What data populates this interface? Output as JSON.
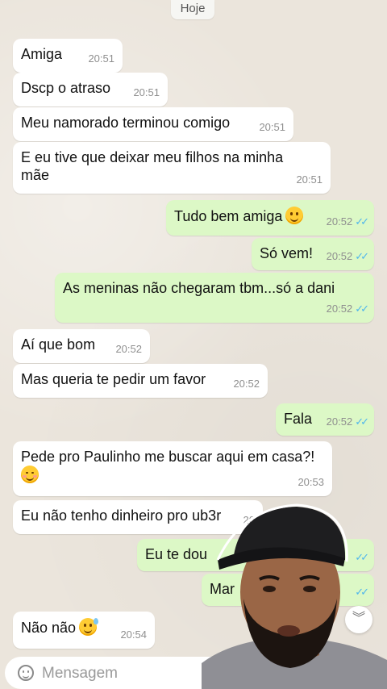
{
  "date_chip": "Hoje",
  "messages": [
    {
      "dir": "in",
      "text": "Amiga",
      "time": "20:51"
    },
    {
      "dir": "in",
      "text": "Dscp o atraso",
      "time": "20:51"
    },
    {
      "dir": "in",
      "text": "Meu namorado terminou comigo",
      "time": "20:51"
    },
    {
      "dir": "in",
      "text": "E eu tive que deixar meu filhos na minha",
      "text2": "mãe",
      "time": "20:51"
    },
    {
      "dir": "out",
      "text": "Tudo bem amiga",
      "time": "20:52",
      "emoji": "smiling-face-icon"
    },
    {
      "dir": "out",
      "text": "Só vem!",
      "time": "20:52"
    },
    {
      "dir": "out",
      "text": "As meninas não chegaram tbm...só a dani",
      "time": "20:52"
    },
    {
      "dir": "in",
      "text": "Aí que bom",
      "time": "20:52"
    },
    {
      "dir": "in",
      "text": "Mas queria te pedir um favor",
      "time": "20:52"
    },
    {
      "dir": "out",
      "text": "Fala",
      "time": "20:52"
    },
    {
      "dir": "in",
      "text": "Pede pro Paulinho me buscar aqui em casa?!",
      "time": "20:53",
      "emoji": "blushing-face-icon"
    },
    {
      "dir": "in",
      "text": "Eu não tenho dinheiro pro ub3r",
      "time": "20"
    },
    {
      "dir": "out",
      "text": "Eu te dou",
      "time": ""
    },
    {
      "dir": "out",
      "text": "Mar",
      "time": ""
    },
    {
      "dir": "in",
      "text": "Não não",
      "time": "20:54",
      "emoji": "grinning-sweat-face-icon"
    }
  ],
  "input": {
    "placeholder": "Mensagem"
  },
  "ticks": "✓✓",
  "colors": {
    "incoming": "#ffffff",
    "outgoing": "#dcf8c6",
    "tick": "#4fb6ec",
    "wallpaper": "#ebe5dc"
  }
}
